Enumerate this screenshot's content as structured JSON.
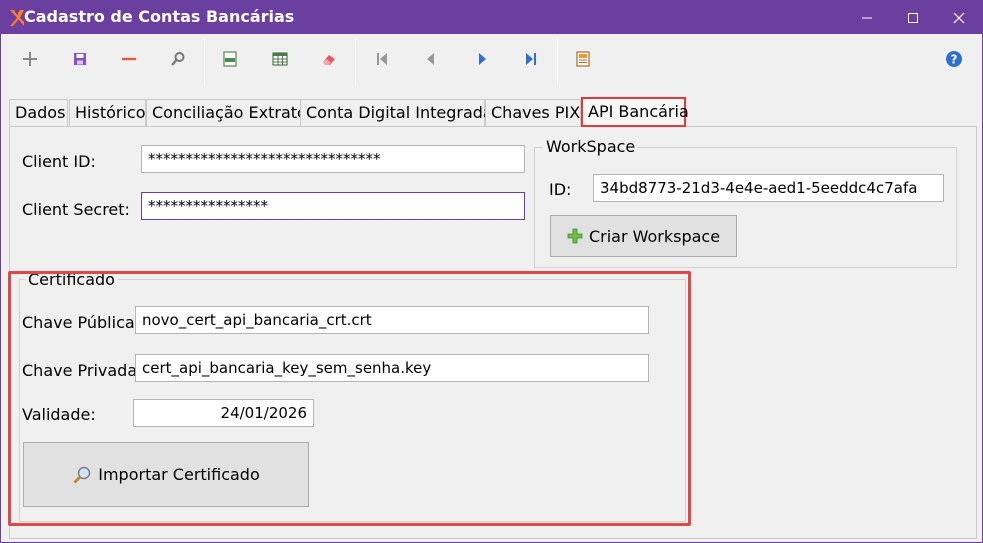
{
  "window": {
    "title": "Cadastro de Contas Bancárias",
    "accent": "#6b3fa0",
    "minimize_glyph": "—",
    "maximize_glyph": "☐",
    "close_glyph": "✕"
  },
  "toolbar": {
    "icons": [
      "add-icon",
      "save-icon",
      "delete-icon",
      "search-icon",
      "export-txt-icon",
      "grid-icon",
      "eraser-icon",
      "first-record-icon",
      "previous-record-icon",
      "next-record-icon",
      "last-record-icon",
      "report-icon",
      "help-icon"
    ]
  },
  "tabs": [
    {
      "label": "Dados"
    },
    {
      "label": "Histórico"
    },
    {
      "label": "Conciliação Extrato"
    },
    {
      "label": "Conta Digital Integrada"
    },
    {
      "label": "Chaves PIX"
    },
    {
      "label": "API Bancária"
    }
  ],
  "api": {
    "client_id_label": "Client ID:",
    "client_id_value": "*******************************",
    "client_secret_label": "Client Secret:",
    "client_secret_value": "****************",
    "workspace": {
      "title": "WorkSpace",
      "id_label": "ID:",
      "id_value": "34bd8773-21d3-4e4e-aed1-5eeddc4c7afa",
      "create_button": "Criar Workspace"
    },
    "certificate": {
      "title": "Certificado",
      "public_key_label": "Chave Pública:",
      "public_key_value": "novo_cert_api_bancaria_crt.crt",
      "private_key_label": "Chave Privada:",
      "private_key_value": "cert_api_bancaria_key_sem_senha.key",
      "validity_label": "Validade:",
      "validity_value": "24/01/2026",
      "import_button": "Importar Certificado"
    }
  },
  "highlight_color": "#e04848"
}
